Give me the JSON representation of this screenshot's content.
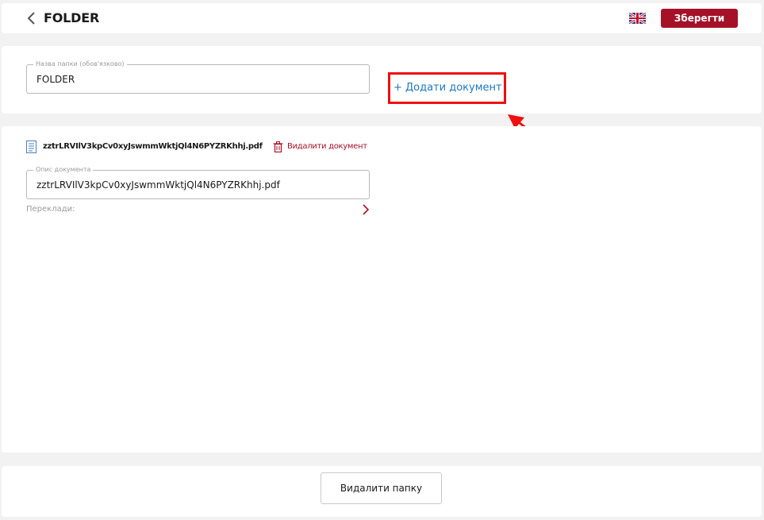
{
  "header": {
    "title": "FOLDER",
    "back_icon": "chevron-left-icon",
    "language_flag": "uk-flag-icon",
    "save_label": "Зберегти",
    "accent_color": "#a51228"
  },
  "folder": {
    "name_label": "Назва папки (обов'язково)",
    "name_value": "FOLDER",
    "add_document_label": "+ Додати документ",
    "highlight_color": "#ee1010"
  },
  "document": {
    "filename": "zztrLRVIlV3kpCv0xyJswmmWktjQl4N6PYZRKhhj.pdf",
    "delete_label": "Видалити документ",
    "description_label": "Опис документа",
    "description_value": "zztrLRVIlV3kpCv0xyJswmmWktjQl4N6PYZRKhhj.pdf",
    "translations_label": "Переклади:"
  },
  "footer": {
    "delete_folder_label": "Видалити папку"
  }
}
